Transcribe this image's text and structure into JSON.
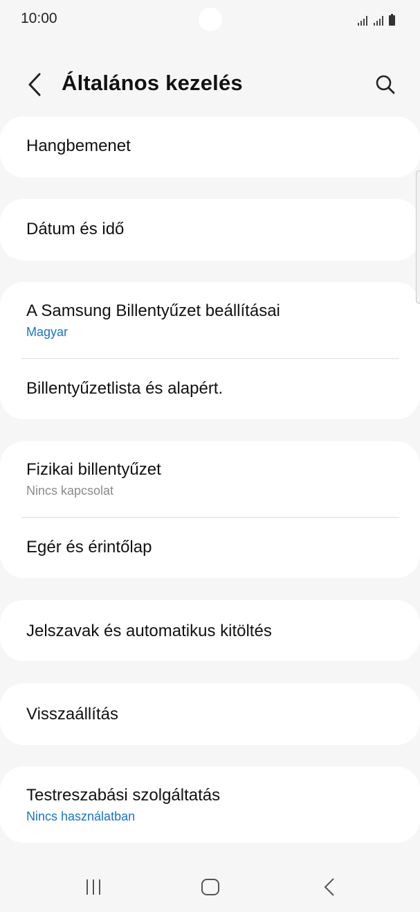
{
  "status_bar": {
    "time": "10:00"
  },
  "header": {
    "title": "Általános kezelés",
    "back_icon": "chevron-left-icon",
    "search_icon": "search-icon"
  },
  "settings": {
    "voice_input": {
      "title": "Hangbemenet"
    },
    "date_time": {
      "title": "Dátum és idő"
    },
    "samsung_keyboard": {
      "title": "A Samsung Billentyűzet beállításai",
      "subtitle": "Magyar"
    },
    "keyboard_list": {
      "title": "Billentyűzetlista és alapért."
    },
    "physical_keyboard": {
      "title": "Fizikai billentyűzet",
      "subtitle": "Nincs kapcsolat"
    },
    "mouse_trackpad": {
      "title": "Egér és érintőlap"
    },
    "passwords_autofill": {
      "title": "Jelszavak és automatikus kitöltés"
    },
    "reset": {
      "title": "Visszaállítás"
    },
    "customization_service": {
      "title": "Testreszabási szolgáltatás",
      "subtitle": "Nincs használatban"
    }
  },
  "colors": {
    "background": "#f6f6f6",
    "card": "#ffffff",
    "accent_blue": "#1a73c8",
    "subtitle_gray": "#8a8a8a"
  },
  "nav_bar": {
    "recents_icon": "recents-icon",
    "home_icon": "home-icon",
    "back_icon": "back-icon"
  }
}
